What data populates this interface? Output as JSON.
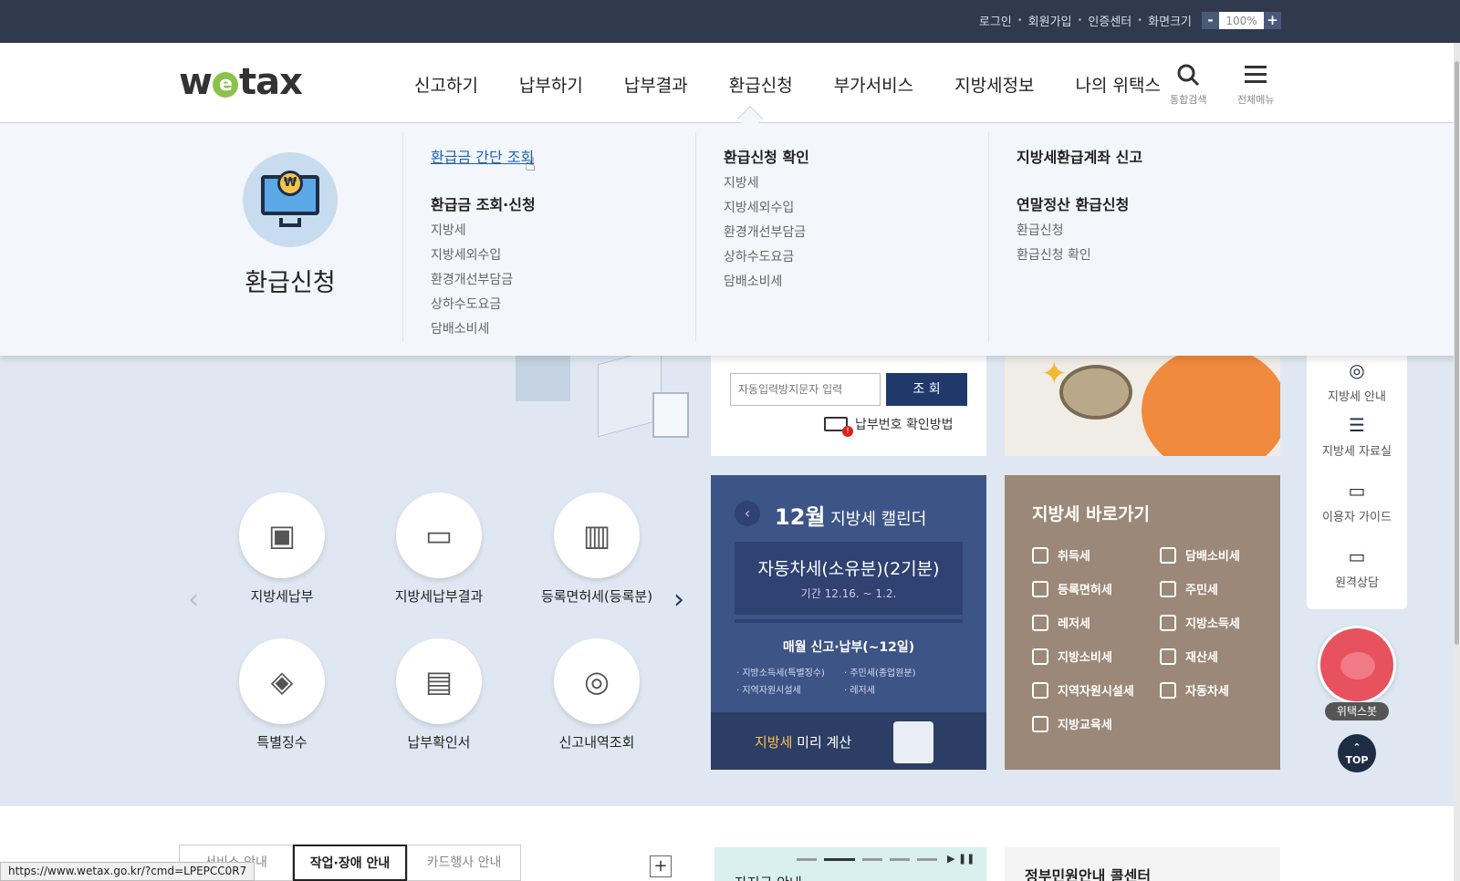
{
  "util": {
    "links": [
      "로그인",
      "회원가입",
      "인증센터",
      "화면크기"
    ],
    "zoom_minus": "-",
    "zoom_value": "100%",
    "zoom_plus": "+"
  },
  "header": {
    "logo_pre": "w",
    "logo_e": "e",
    "logo_post": "tax",
    "nav": [
      "신고하기",
      "납부하기",
      "납부결과",
      "환급신청",
      "부가서비스",
      "지방세정보",
      "나의 위택스"
    ],
    "search_label": "통합검색",
    "menu_label": "전체메뉴"
  },
  "mega": {
    "title": "환급신청",
    "coin_symbol": "₩",
    "col1": {
      "link": "환급금 간단 조회",
      "heading": "환급금 조회·신청",
      "items": [
        "지방세",
        "지방세외수입",
        "환경개선부담금",
        "상하수도요금",
        "담배소비세"
      ]
    },
    "col2": {
      "heading": "환급신청 확인",
      "items": [
        "지방세",
        "지방세외수입",
        "환경개선부담금",
        "상하수도요금",
        "담배소비세"
      ]
    },
    "col3": {
      "heading1": "지방세환급계좌 신고",
      "heading2": "연말정산 환급신청",
      "items": [
        "환급신청",
        "환급신청 확인"
      ]
    }
  },
  "lookup": {
    "captcha_placeholder": "자동입력방지문자 입력",
    "button": "조 회",
    "help": "납부번호 확인방법"
  },
  "quick": [
    {
      "label": "지방세납부",
      "glyph": "▣"
    },
    {
      "label": "지방세납부결과",
      "glyph": "▭"
    },
    {
      "label": "등록면허세(등록분)",
      "glyph": "▥"
    },
    {
      "label": "특별징수",
      "glyph": "◈"
    },
    {
      "label": "납부확인서",
      "glyph": "▤"
    },
    {
      "label": "신고내역조회",
      "glyph": "◎"
    }
  ],
  "calendar": {
    "month": "12월",
    "title_suffix": "지방세 캘린더",
    "event": "자동차세(소유분)(2기분)",
    "period": "기간 12.16. ~ 1.2.",
    "monthly": "매월 신고·납부(~12일)",
    "items": [
      "지방소득세(특별징수)",
      "주민세(종업원분)",
      "지역자원시설세",
      "레저세"
    ],
    "calc_highlight": "지방세",
    "calc_rest": " 미리 계산"
  },
  "shortcuts": {
    "title": "지방세 바로가기",
    "items": [
      "취득세",
      "담배소비세",
      "등록면허세",
      "주민세",
      "레저세",
      "지방소득세",
      "지방소비세",
      "재산세",
      "지역자원시설세",
      "자동차세",
      "지방교육세"
    ]
  },
  "side": {
    "items": [
      "지방세 안내",
      "지방세 자료실",
      "이용자 가이드",
      "원격상담"
    ],
    "bot_label": "위택스봇",
    "top": "TOP"
  },
  "lower": {
    "tabs": [
      "서비스 안내",
      "작업·장애 안내",
      "카드행사 안내"
    ],
    "plus": "+",
    "notice1_title": "자지금 안내",
    "notice2_title": "정부민원안내 콜센터"
  },
  "status_url": "https://www.wetax.go.kr/?cmd=LPEPCC0R7"
}
